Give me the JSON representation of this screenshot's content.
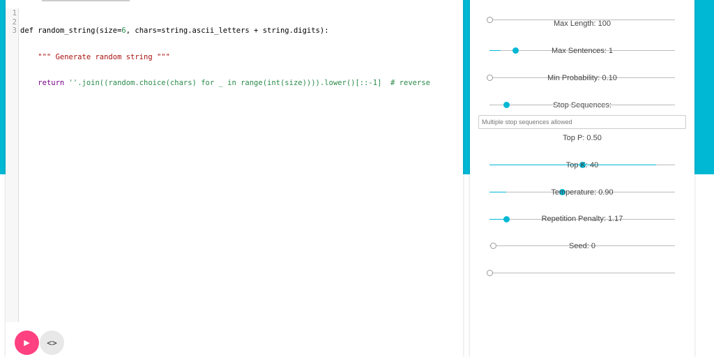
{
  "editor": {
    "line_numbers": [
      "1",
      "2",
      "3"
    ],
    "line1": {
      "a": "def random_string(size=",
      "b": "6",
      "c": ", chars=string.ascii_letters + string.digits):"
    },
    "line2": "    \"\"\" Generate random string \"\"\"",
    "line3": {
      "indent": "    ",
      "kw": "return",
      "rest": " ''.join((random.choice(chars) for _ in range(int(size)))).lower()[::-1]  # reverse"
    }
  },
  "buttons": {
    "run_icon": "▶",
    "code_icon": "<>"
  },
  "settings": {
    "sliders": [
      {
        "label": "",
        "value": 0,
        "fill": 0
      },
      {
        "label": "Max Length: 100",
        "value": 0.14,
        "fill": 0.06
      },
      {
        "label": "Max Sentences: 1",
        "value": 0.0,
        "fill": 0
      },
      {
        "label": "Min Probability: 0.10",
        "value": 0.09,
        "fill": 0
      },
      {
        "label": "Top P: 0.50",
        "value": 0.5,
        "fill": 0.9
      },
      {
        "label": "Top K: 40",
        "value": 0.39,
        "fill": 0.09
      },
      {
        "label": "Temperature: 0.90",
        "value": 0.09,
        "fill": 0.09
      },
      {
        "label": "Repetition Penalty: 1.17",
        "value": 0.02,
        "fill": 0
      },
      {
        "label": "Seed: 0",
        "value": 0,
        "fill": 0
      }
    ],
    "stop_label": "Stop Sequences:",
    "stop_placeholder": "Multiple stop sequences allowed"
  }
}
